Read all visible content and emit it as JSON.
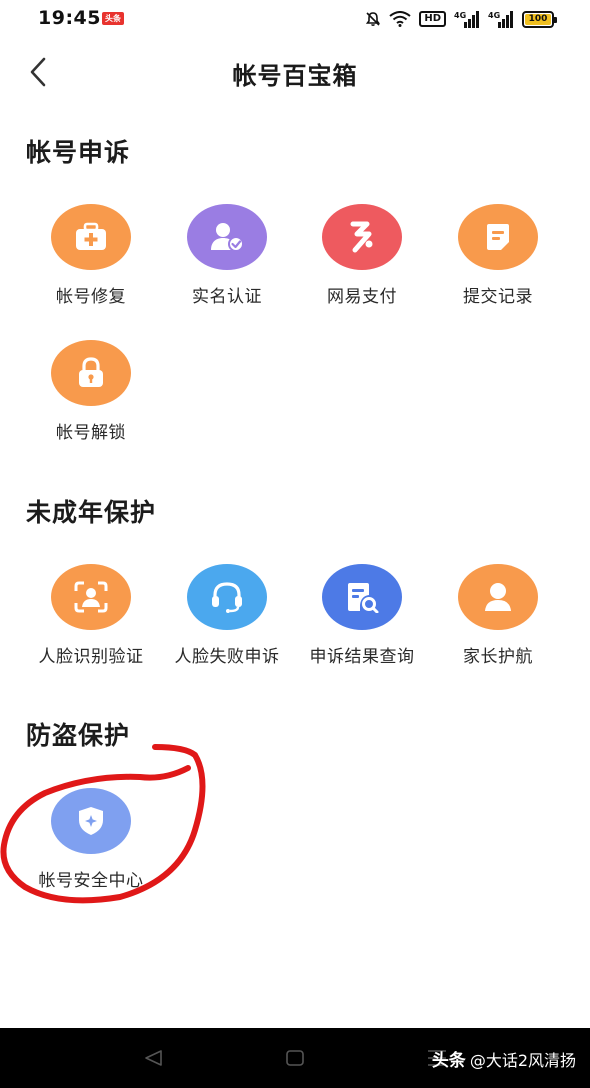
{
  "status_bar": {
    "time": "19:45",
    "app_badge": "头条",
    "network_label_1": "4G",
    "network_label_2": "4G",
    "hd_label": "HD",
    "battery_level": "100",
    "icons": [
      "mute-icon",
      "wifi-icon",
      "hd-icon",
      "signal-icon",
      "signal-icon",
      "battery-icon"
    ]
  },
  "header": {
    "title": "帐号百宝箱",
    "back_icon": "chevron-left-icon"
  },
  "sections": [
    {
      "title": "帐号申诉",
      "items": [
        {
          "label": "帐号修复",
          "icon": "medical-kit-icon",
          "color": "#f89a4c"
        },
        {
          "label": "实名认证",
          "icon": "user-verified-icon",
          "color": "#9a7de3"
        },
        {
          "label": "网易支付",
          "icon": "netease-pay-icon",
          "color": "#ee5a5f"
        },
        {
          "label": "提交记录",
          "icon": "document-icon",
          "color": "#f89a4c"
        },
        {
          "label": "帐号解锁",
          "icon": "lock-icon",
          "color": "#f89a4c"
        }
      ]
    },
    {
      "title": "未成年保护",
      "items": [
        {
          "label": "人脸识别验证",
          "icon": "face-scan-icon",
          "color": "#f89a4c"
        },
        {
          "label": "人脸失败申诉",
          "icon": "headset-icon",
          "color": "#4ba8ee"
        },
        {
          "label": "申诉结果查询",
          "icon": "search-document-icon",
          "color": "#4d7ae6"
        },
        {
          "label": "家长护航",
          "icon": "parent-icon",
          "color": "#f89a4c"
        }
      ]
    },
    {
      "title": "防盗保护",
      "items": [
        {
          "label": "帐号安全中心",
          "icon": "shield-icon",
          "color": "#7fa0f0"
        }
      ]
    }
  ],
  "annotation": {
    "color": "#e01818"
  },
  "bottom_bar": {
    "watermark_brand": "头条",
    "watermark_handle": "@大话2风清扬"
  }
}
